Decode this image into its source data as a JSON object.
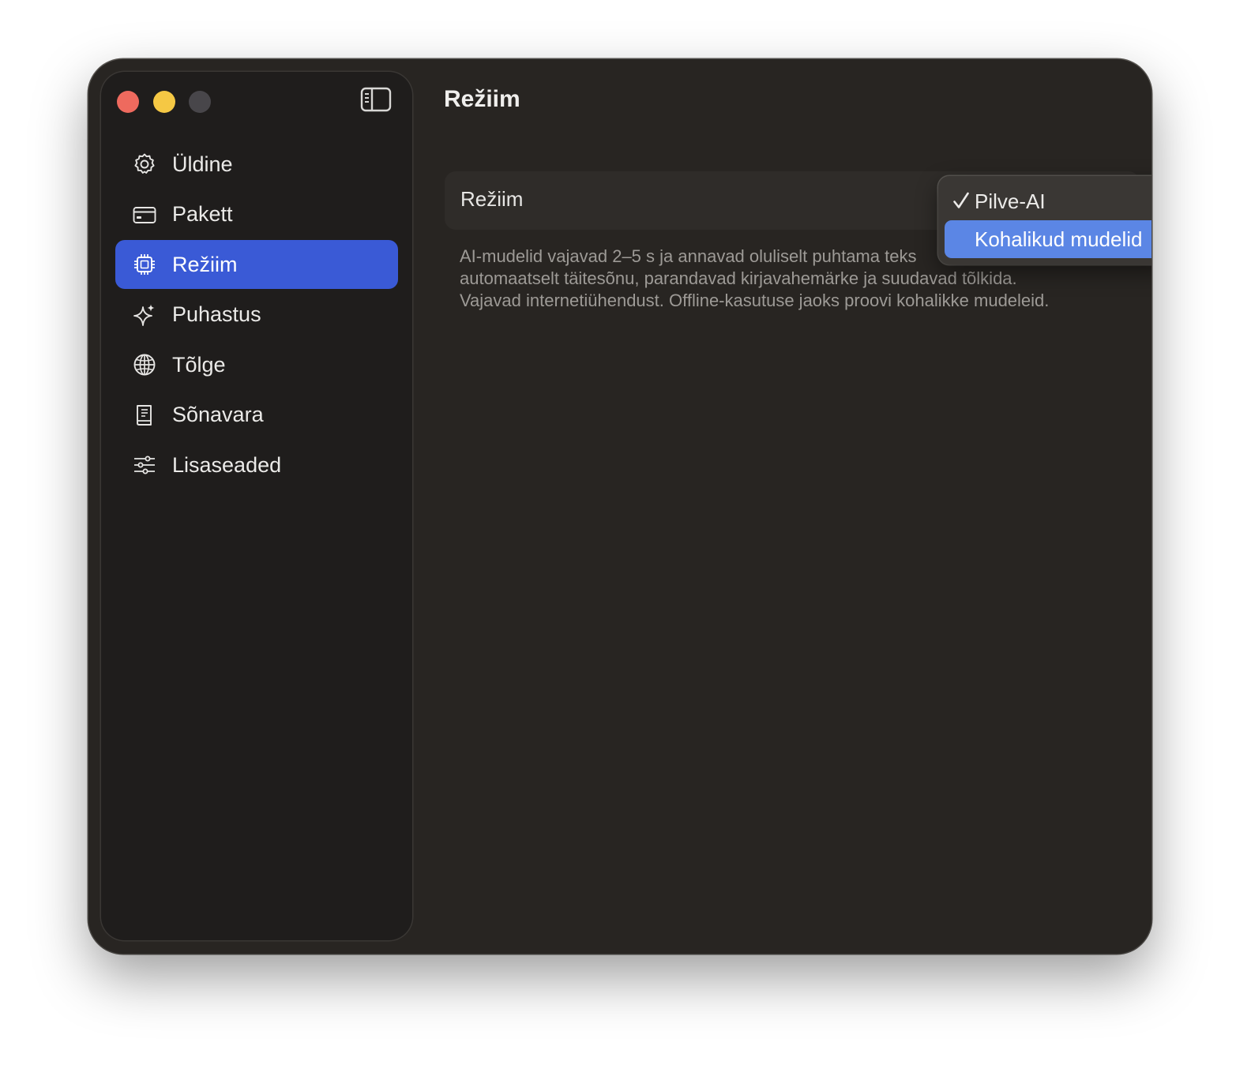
{
  "window": {
    "traffic_lights": [
      "close",
      "minimize",
      "maximize"
    ]
  },
  "sidebar": {
    "toggle_icon": "sidebar-icon",
    "items": [
      {
        "label": "Üldine",
        "icon": "gear-icon",
        "active": false
      },
      {
        "label": "Pakett",
        "icon": "credit-card-icon",
        "active": false
      },
      {
        "label": "Režiim",
        "icon": "cpu-chip-icon",
        "active": true
      },
      {
        "label": "Puhastus",
        "icon": "sparkles-icon",
        "active": false
      },
      {
        "label": "Tõlge",
        "icon": "globe-icon",
        "active": false
      },
      {
        "label": "Sõnavara",
        "icon": "book-icon",
        "active": false
      },
      {
        "label": "Lisaseaded",
        "icon": "sliders-icon",
        "active": false
      }
    ]
  },
  "main": {
    "title": "Režiim",
    "setting": {
      "label": "Režiim"
    },
    "description": [
      "AI-mudelid vajavad 2–5 s ja annavad oluliselt puhtama teks",
      "automaatselt täitesõnu, parandavad kirjavahemärke ja suudavad tõlkida.",
      "Vajavad internetiühendust. Offline-kasutuse jaoks proovi kohalikke mudeleid."
    ],
    "dropdown": {
      "options": [
        {
          "label": "Pilve-AI",
          "checked": true,
          "highlighted": false
        },
        {
          "label": "Kohalikud mudelid",
          "checked": false,
          "highlighted": true
        }
      ]
    }
  },
  "colors": {
    "accent": "#3a5ad6",
    "menu_highlight": "#5b86e5",
    "window_bg": "#282522",
    "sidebar_bg": "#1f1d1c"
  }
}
